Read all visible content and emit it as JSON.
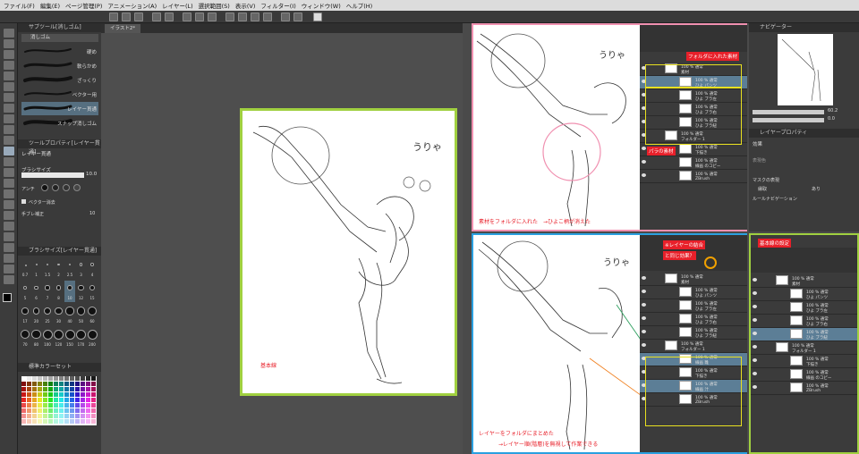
{
  "menu": [
    "ファイル(F)",
    "編集(E)",
    "ページ管理(P)",
    "アニメーション(A)",
    "レイヤー(L)",
    "選択範囲(S)",
    "表示(V)",
    "フィルター(I)",
    "ウィンドウ(W)",
    "ヘルプ(H)"
  ],
  "subtool": {
    "title": "サブツール[消しゴム]",
    "group": "消しゴム",
    "brushes": [
      {
        "label": "硬め",
        "selected": false
      },
      {
        "label": "軟らかめ",
        "selected": false
      },
      {
        "label": "ざっくり",
        "selected": false
      },
      {
        "label": "ベクター用",
        "selected": false
      },
      {
        "label": "レイヤー貫通",
        "selected": true
      },
      {
        "label": "スナップ消しゴム",
        "selected": false
      }
    ]
  },
  "tool_property": {
    "title": "ツールプロパティ[レイヤー貫通]",
    "name": "レイヤー貫通",
    "size_label": "ブラシサイズ",
    "size_value": "10.0",
    "aa_label": "アンチ",
    "vector_label": "ベクター消去",
    "stabilize_label": "手ブレ補正",
    "stabilize_value": "10"
  },
  "brush_size_panel": {
    "title": "ブラシサイズ[レイヤー貫通]",
    "sizes": [
      "0.7",
      "1",
      "1.5",
      "2",
      "2.5",
      "3",
      "4",
      "5",
      "6",
      "7",
      "8",
      "10",
      "12",
      "15",
      "17",
      "20",
      "25",
      "30",
      "40",
      "50",
      "60",
      "70",
      "80",
      "100",
      "120",
      "150",
      "170",
      "200"
    ]
  },
  "color_set": {
    "title": "標準カラーセット"
  },
  "canvas_tab": "イラスト2*",
  "main_label": "基本線",
  "scribble": "うりゃ",
  "top_pane": {
    "frame_color": "#f090b0",
    "callout_folder": "フォルダに入れた素材",
    "callout_parts": "パラの素材",
    "caption": "素材をフォルダに入れた　→ひよこ柄が消えた",
    "layers": [
      {
        "mode": "100 % 通常",
        "name": "素材"
      },
      {
        "mode": "100 % 通常",
        "name": "ひよ パンツ"
      },
      {
        "mode": "100 % 通常",
        "name": "ひよ ブラ左"
      },
      {
        "mode": "100 % 通常",
        "name": "ひよ ブラ右"
      },
      {
        "mode": "100 % 通常",
        "name": "ひよ ブラ紐"
      },
      {
        "mode": "100 % 通常",
        "name": "フォルダー 1"
      },
      {
        "mode": "100 % 通常",
        "name": "下描き"
      },
      {
        "mode": "100 % 通常",
        "name": "線画 のコピー"
      },
      {
        "mode": "100 % 通常",
        "name": "ZBrush"
      }
    ]
  },
  "bottom_pane": {
    "frame_color": "#2aa0e0",
    "callout_merge_1": "※レイヤーの結合",
    "callout_merge_2": "と同じ効果？",
    "caption_1": "レイヤーをフォルダにまとめた",
    "caption_2": "→レイヤー順(階層)を無視して作業できる",
    "layers": [
      {
        "mode": "100 % 通常",
        "name": "素材"
      },
      {
        "mode": "100 % 通常",
        "name": "ひよ パンツ"
      },
      {
        "mode": "100 % 通常",
        "name": "ひよ ブラ左"
      },
      {
        "mode": "100 % 通常",
        "name": "ひよ ブラ右"
      },
      {
        "mode": "100 % 通常",
        "name": "ひよ ブラ紐"
      },
      {
        "mode": "100 % 通常",
        "name": "フォルダー 1"
      },
      {
        "mode": "100 % 通常",
        "name": "線画 雛"
      },
      {
        "mode": "100 % 通常",
        "name": "下描き"
      },
      {
        "mode": "100 % 通常",
        "name": "線画 汁"
      },
      {
        "mode": "100 % 通常",
        "name": "ZBrush"
      }
    ]
  },
  "right_column": {
    "navigator_title": "ナビゲーター",
    "zoom": "60.2",
    "angle": "0.0",
    "layer_property_title": "レイヤープロパティ",
    "effect_label": "効果",
    "expression_label": "表現色",
    "mask_label": "マスクの表現",
    "mask_value_1": "縁取",
    "mask_value_2": "あり",
    "ruler_label": "ルールナビゲーション",
    "callout_base": "基本線の設定",
    "frame_color": "#a0d040",
    "layers": [
      {
        "mode": "100 % 通常",
        "name": "素材"
      },
      {
        "mode": "100 % 通常",
        "name": "ひよ パンツ"
      },
      {
        "mode": "100 % 通常",
        "name": "ひよ ブラ左"
      },
      {
        "mode": "100 % 通常",
        "name": "ひよ ブラ右"
      },
      {
        "mode": "100 % 通常",
        "name": "ひよ ブラ紐"
      },
      {
        "mode": "100 % 通常",
        "name": "フォルダー 1"
      },
      {
        "mode": "100 % 通常",
        "name": "下描き"
      },
      {
        "mode": "100 % 通常",
        "name": "線画 のコピー"
      },
      {
        "mode": "100 % 通常",
        "name": "ZBrush"
      }
    ]
  },
  "colors": {
    "accent_red": "#e8202a",
    "highlight_yellow": "#e8e020",
    "main_frame": "#a0d040",
    "selected_row": "#5c7e96"
  }
}
